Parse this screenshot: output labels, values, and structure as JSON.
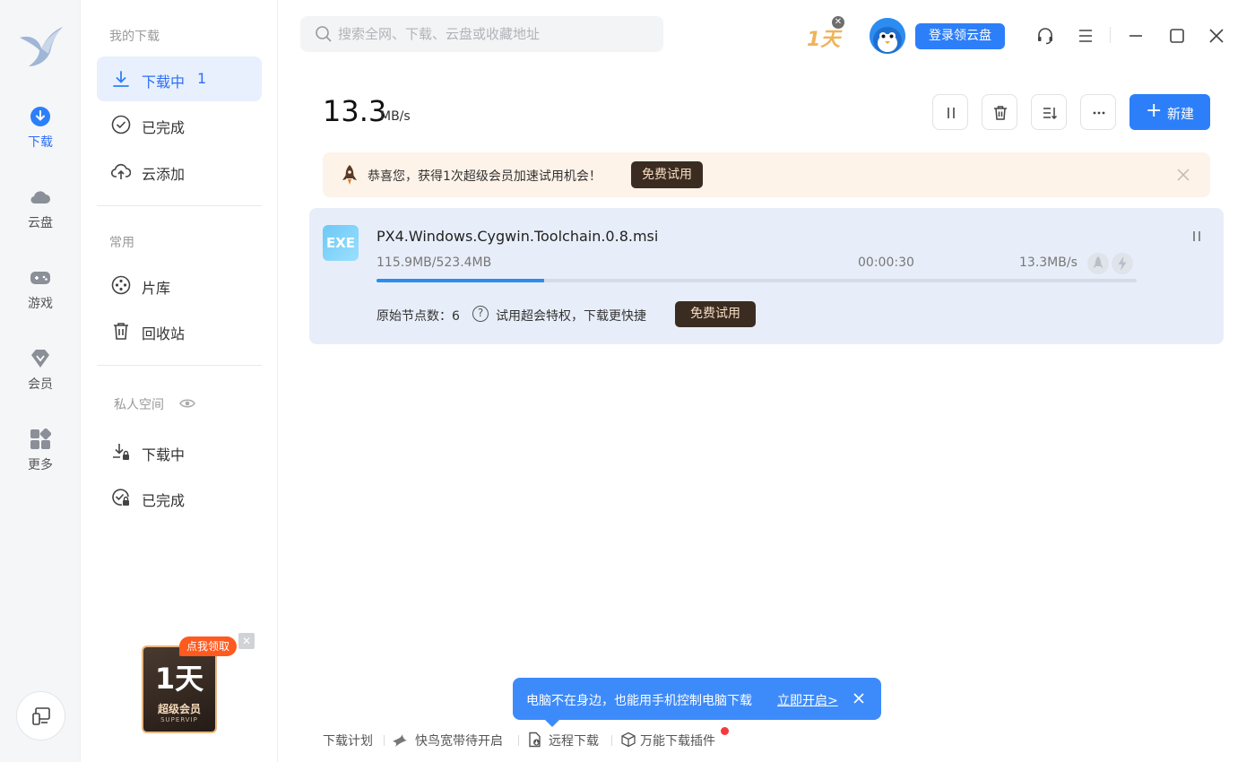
{
  "rail": {
    "items": [
      {
        "label": "下载",
        "icon": "download-circle-icon",
        "active": true
      },
      {
        "label": "云盘",
        "icon": "cloud-icon"
      },
      {
        "label": "游戏",
        "icon": "gamepad-icon"
      },
      {
        "label": "会员",
        "icon": "diamond-icon"
      },
      {
        "label": "更多",
        "icon": "grid-icon"
      }
    ]
  },
  "sidebar": {
    "section_my": "我的下载",
    "downloading": {
      "label": "下载中",
      "count": "1"
    },
    "completed": "已完成",
    "cloud_add": "云添加",
    "section_common": "常用",
    "library": "片库",
    "recycle": "回收站",
    "section_private": "私人空间",
    "private_downloading": "下载中",
    "private_completed": "已完成"
  },
  "promo": {
    "tag": "点我领取",
    "big": "1天",
    "title": "超级会员",
    "sub": "SUPERVIP"
  },
  "search": {
    "placeholder": "搜索全网、下载、云盘或收藏地址"
  },
  "topbar": {
    "badge_oneday": "1天",
    "login_label": "登录领云盘"
  },
  "speed": {
    "value": "13.3",
    "unit": "MB/s"
  },
  "toolbar": {
    "new_label": "新建"
  },
  "banner": {
    "message": "恭喜您，获得1次超级会员加速试用机会！",
    "trial_label": "免费试用"
  },
  "task": {
    "file_type": "EXE",
    "file_name": "PX4.Windows.Cygwin.Toolchain.0.8.msi",
    "size_progress": "115.9MB/523.4MB",
    "remaining_time": "00:00:30",
    "rate": "13.3MB/s",
    "progress_fraction": 0.221,
    "nodes_label": "原始节点数：6",
    "hint": "试用超会特权，下载更快捷",
    "trial_label": "免费试用"
  },
  "tooltip": {
    "text": "电脑不在身边，也能用手机控制电脑下载",
    "link": "立即开启>"
  },
  "footer": {
    "plan": "下载计划",
    "broadband": "快鸟宽带待开启",
    "remote": "远程下载",
    "plugin": "万能下载插件"
  },
  "colors": {
    "accent": "#2d7ff9",
    "trial_bg": "#3b2c22",
    "banner_bg": "#fdf3e9",
    "task_bg": "#e8eef9"
  }
}
